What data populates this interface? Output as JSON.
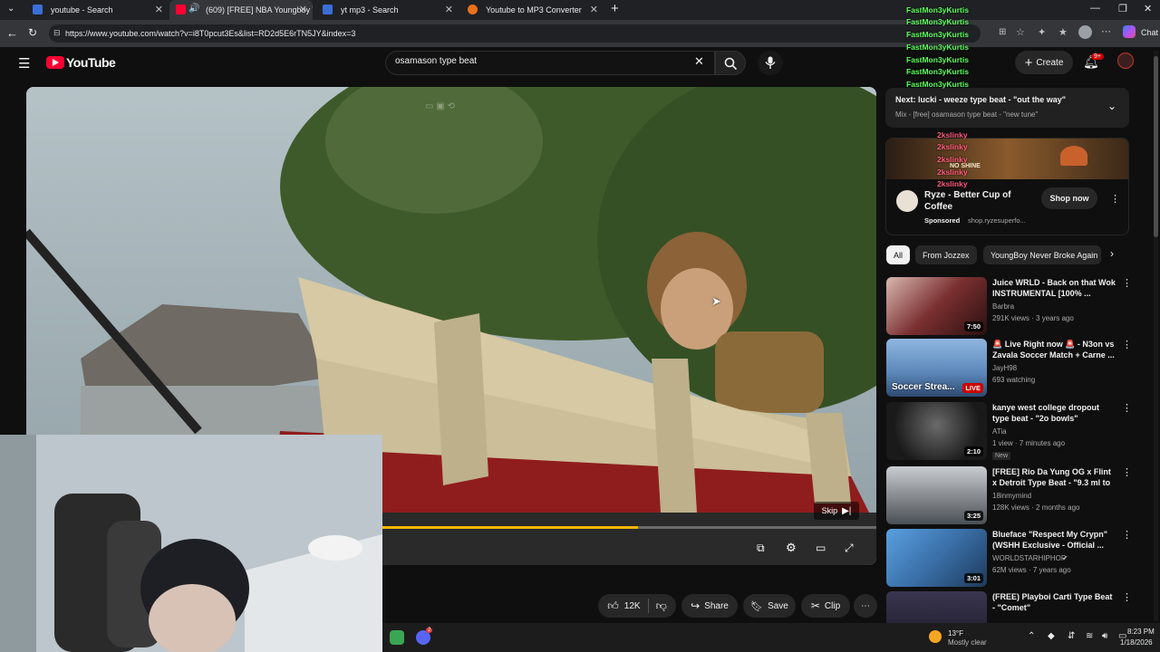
{
  "browser": {
    "tabs": [
      {
        "title": "youtube - Search"
      },
      {
        "title": "(609) [FREE] NBA Youngboy Ty"
      },
      {
        "title": "yt mp3 - Search"
      },
      {
        "title": "Youtube to MP3 Converter"
      }
    ],
    "new_tab": "+",
    "url": "https://www.youtube.com/watch?v=i8T0pcut3Es&list=RD2d5E6rTN5JY&index=3",
    "chat_label": "Chat"
  },
  "youtube": {
    "logo_text": "YouTube",
    "search_value": "osamason type beat",
    "create_label": "Create",
    "notif_count": "9+"
  },
  "player": {
    "skip_label": "Skip",
    "progress": 0.72
  },
  "actions": {
    "likes": "12K",
    "share": "Share",
    "save": "Save",
    "clip": "Clip"
  },
  "queue": {
    "next_label": "Next: lucki - weeze type beat - \"out the way\"",
    "mix_label": "Mix - [free] osamason type beat - \"new tune\""
  },
  "ad": {
    "title": "Ryze - Better Cup of Coffee",
    "sponsor": "Sponsored",
    "domain": "shop.ryzesuperfo...",
    "cta": "Shop now",
    "banner_text": "NO SHINE"
  },
  "chips": [
    "All",
    "From Jozzex",
    "YoungBoy Never Broke Again"
  ],
  "videos": [
    {
      "title": "Juice WRLD - Back on that Wok INSTRUMENTAL [100% ...",
      "channel": "Barbra",
      "meta": "291K views · 3 years ago",
      "duration": "7:50",
      "thumb_color": "#7a2f30"
    },
    {
      "title": "🚨 Live Right now 🚨 - N3on vs Zavala Soccer Match + Carne ...",
      "channel": "JayH98",
      "meta": "693 watching",
      "duration": "LIVE",
      "thumb_text": "Soccer Strea...",
      "thumb_color": "#5a86b8"
    },
    {
      "title": "kanye west college dropout type beat - \"2o bowls\"",
      "channel": "ATia",
      "meta": "1 view · 7 minutes ago",
      "badge": "New",
      "duration": "2:10",
      "thumb_color": "#2a2a2a"
    },
    {
      "title": "[FREE] Rio Da Yung OG x Flint x Detroit Type Beat - \"9.3 ml to ...",
      "channel": "18inmymind",
      "meta": "128K views · 2 months ago",
      "duration": "3:25",
      "thumb_color": "#4a4f55"
    },
    {
      "title": "Blueface \"Respect My Crypn\" (WSHH Exclusive - Official ...",
      "channel": "WORLDSTARHIPHOP",
      "meta": "62M views · 7 years ago",
      "duration": "3:01",
      "thumb_color": "#3a6fa8"
    },
    {
      "title": "(FREE) Playboi Carti Type Beat - \"Comet\"",
      "channel": "",
      "meta": "",
      "duration": "",
      "thumb_color": "#3a3650"
    }
  ],
  "chat": [
    "FastMon3yKurtis",
    "FastMon3yKurtis",
    "FastMon3yKurtis",
    "FastMon3yKurtis",
    "FastMon3yKurtis",
    "FastMon3yKurtis",
    "FastMon3yKurtis"
  ],
  "chat_secondary": [
    "2kslinky",
    "2kslinky",
    "2kslinky",
    "2kslinky",
    "2kslinky"
  ],
  "taskbar": {
    "temp": "13°F",
    "weather": "Mostly clear",
    "time": "8:23 PM",
    "date": "1/18/2026",
    "discord_badge": "2"
  },
  "colors": {
    "progress": "#f2b500",
    "accent_red": "#ff0033",
    "chat_green": "#5cff5c"
  }
}
